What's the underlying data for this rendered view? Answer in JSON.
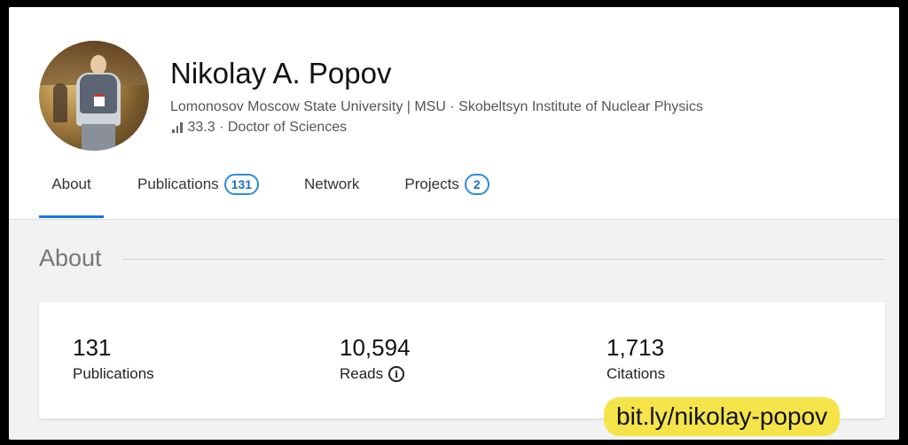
{
  "profile": {
    "name": "Nikolay A. Popov",
    "affiliation": "Lomonosov Moscow State University | MSU · Skobeltsyn Institute of Nuclear Physics",
    "score": "33.3 · Doctor of Sciences",
    "score_icon": "bar-chart-icon"
  },
  "tabs": [
    {
      "label": "About",
      "active": true
    },
    {
      "label": "Publications",
      "count": "131"
    },
    {
      "label": "Network"
    },
    {
      "label": "Projects",
      "count": "2"
    }
  ],
  "about": {
    "title": "About",
    "stats": [
      {
        "value": "131",
        "label": "Publications"
      },
      {
        "value": "10,594",
        "label": "Reads",
        "icon": "info-icon"
      },
      {
        "value": "1,713",
        "label": "Citations"
      }
    ]
  },
  "overlay": {
    "url": "bit.ly/nikolay-popov",
    "color": "#f4e44a"
  },
  "colors": {
    "accent": "#1a73e8",
    "pill_border": "#2a8bd8"
  }
}
